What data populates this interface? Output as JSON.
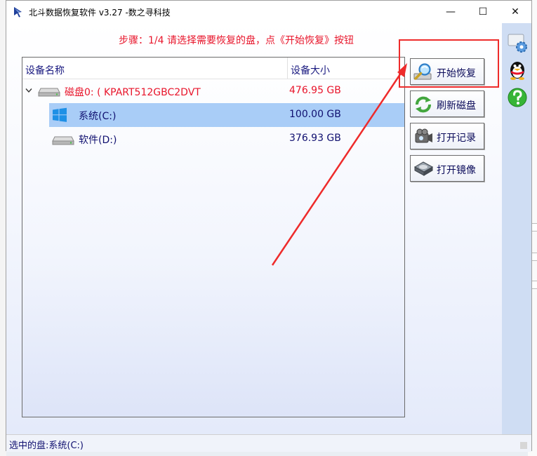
{
  "window": {
    "title": "北斗数据恢复软件 v3.27 -数之寻科技",
    "controls": [
      "—",
      "☐",
      "✕"
    ]
  },
  "step_hint": "步骤：1/4 请选择需要恢复的盘，点《开始恢复》按钮",
  "device_list": {
    "columns": [
      "设备名称",
      "设备大小"
    ],
    "disk": {
      "name": "磁盘0: ( KPART512GBC2DVT",
      "size": "476.95 GB",
      "expanded": true
    },
    "partitions": [
      {
        "name": "系统(C:)",
        "size": "100.00 GB",
        "selected": true,
        "icon": "windows-drive-icon"
      },
      {
        "name": "软件(D:)",
        "size": "376.93 GB",
        "selected": false,
        "icon": "hard-drive-icon"
      }
    ]
  },
  "actions": [
    {
      "label": "开始恢复",
      "icon": "magnifier-drive-icon"
    },
    {
      "label": "刷新磁盘",
      "icon": "refresh-icon"
    },
    {
      "label": "打开记录",
      "icon": "camcorder-icon"
    },
    {
      "label": "打开镜像",
      "icon": "disk-image-icon"
    }
  ],
  "side_icons": [
    "settings-gear-icon",
    "qq-penguin-icon",
    "help-icon"
  ],
  "status": "选中的盘:系统(C:)",
  "colors": {
    "accent_red": "#e8152b",
    "text_navy": "#101070",
    "selection": "#a9cdf7",
    "side_panel": "#cfddf3"
  }
}
